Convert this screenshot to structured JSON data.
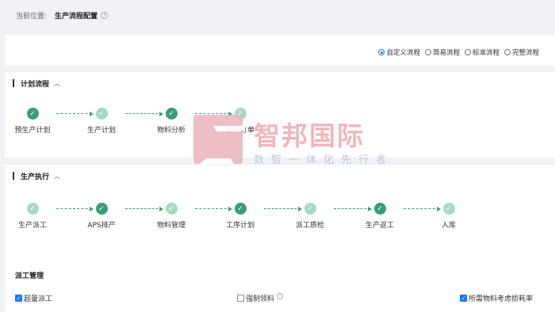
{
  "breadcrumb": {
    "label": "当前位置:",
    "current": "生产流程配置",
    "help_icon": "question-circle-icon"
  },
  "flow_types": {
    "selected": "自定义流程",
    "options": [
      "自定义流程",
      "简易流程",
      "标准流程",
      "完整流程"
    ]
  },
  "plan_section": {
    "title": "计划流程",
    "collapse_icon": "chevron-up-icon",
    "steps": [
      {
        "label": "预生产计划",
        "state": "dark"
      },
      {
        "label": "生产计划",
        "state": "light"
      },
      {
        "label": "物料分析",
        "state": "dark"
      },
      {
        "label": "生产订单",
        "state": "light"
      }
    ]
  },
  "exec_section": {
    "title": "生产执行",
    "collapse_icon": "chevron-up-icon",
    "steps": [
      {
        "label": "生产派工",
        "state": "light"
      },
      {
        "label": "APS排产",
        "state": "dark"
      },
      {
        "label": "物料管理",
        "state": "light"
      },
      {
        "label": "工序计划",
        "state": "dark"
      },
      {
        "label": "派工质检",
        "state": "light"
      },
      {
        "label": "生产返工",
        "state": "dark"
      },
      {
        "label": "入库",
        "state": "light"
      }
    ]
  },
  "dispatch": {
    "title": "派工管理",
    "options": [
      {
        "label": "超量派工",
        "checked": true
      },
      {
        "label": "强制领料",
        "checked": false,
        "info_icon": "info-circle-icon"
      },
      {
        "label": "所需物料考虑损耗率",
        "checked": true
      }
    ]
  },
  "watermark": {
    "brand": "智邦国际",
    "slogan": "数智一体化先行者"
  },
  "colors": {
    "step_dark": "#3a9e73",
    "step_light": "#a5dcc1",
    "accent": "#1677ff"
  }
}
